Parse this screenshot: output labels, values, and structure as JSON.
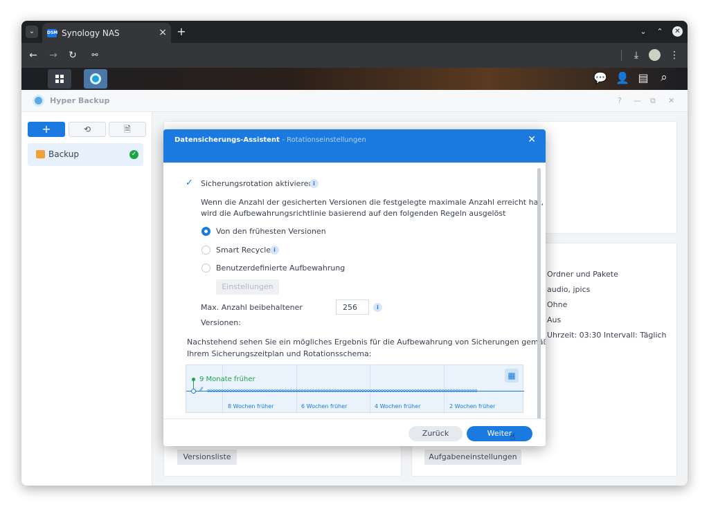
{
  "browser": {
    "tab_title": "Synology NAS",
    "favicon_text": "DSM",
    "colors": {
      "chrome_dark": "#202124",
      "toolbar": "#35363a"
    }
  },
  "app": {
    "title": "Hyper Backup",
    "header_controls": [
      "?",
      "—",
      "⧉",
      "✕"
    ],
    "left_buttons": {
      "add": "+",
      "restore": "⟲",
      "log": "🗎"
    },
    "backup_item": "Backup",
    "right_info": [
      "Ordner und Pakete",
      "audio, jpics",
      "Ohne",
      "Aus",
      "Uhrzeit: 03:30 Intervall: Täglich"
    ],
    "buttons": {
      "version_list": "Versionsliste",
      "task_settings": "Aufgabeneinstellungen"
    }
  },
  "dialog": {
    "title": "Datensicherungs-Assistent",
    "subtitle": "Rotationseinstellungen",
    "enable_rotation": "Sicherungsrotation aktivieren",
    "enable_rotation_checked": true,
    "description_line1": "Wenn die Anzahl der gesicherten Versionen die festgelegte maximale Anzahl erreicht hat,",
    "description_line2": "wird die Aufbewahrungsrichtlinie basierend auf den folgenden Regeln ausgelöst",
    "options": [
      {
        "label": "Von den frühesten Versionen",
        "selected": true
      },
      {
        "label": "Smart Recycle",
        "selected": false
      },
      {
        "label": "Benutzerdefinierte Aufbewahrung",
        "selected": false
      }
    ],
    "settings_button": "Einstellungen",
    "max_versions_label_line1": "Max. Anzahl beibehaltener",
    "max_versions_label_line2": "Versionen:",
    "max_versions_value": "256",
    "result_line1": "Nachstehend sehen Sie ein mögliches Ergebnis für die Aufbewahrung von Sicherungen gemäß",
    "result_line2": "Ihrem Sicherungszeitplan und Rotationsschema:",
    "timeline": {
      "start_label": "9 Monate früher",
      "week_labels": [
        "8 Wochen früher",
        "6 Wochen früher",
        "4 Wochen früher",
        "2 Wochen früher"
      ]
    },
    "back_button": "Zurück",
    "next_button": "Weiter",
    "colors": {
      "accent": "#1a7ae0",
      "green": "#1fa34a"
    }
  }
}
